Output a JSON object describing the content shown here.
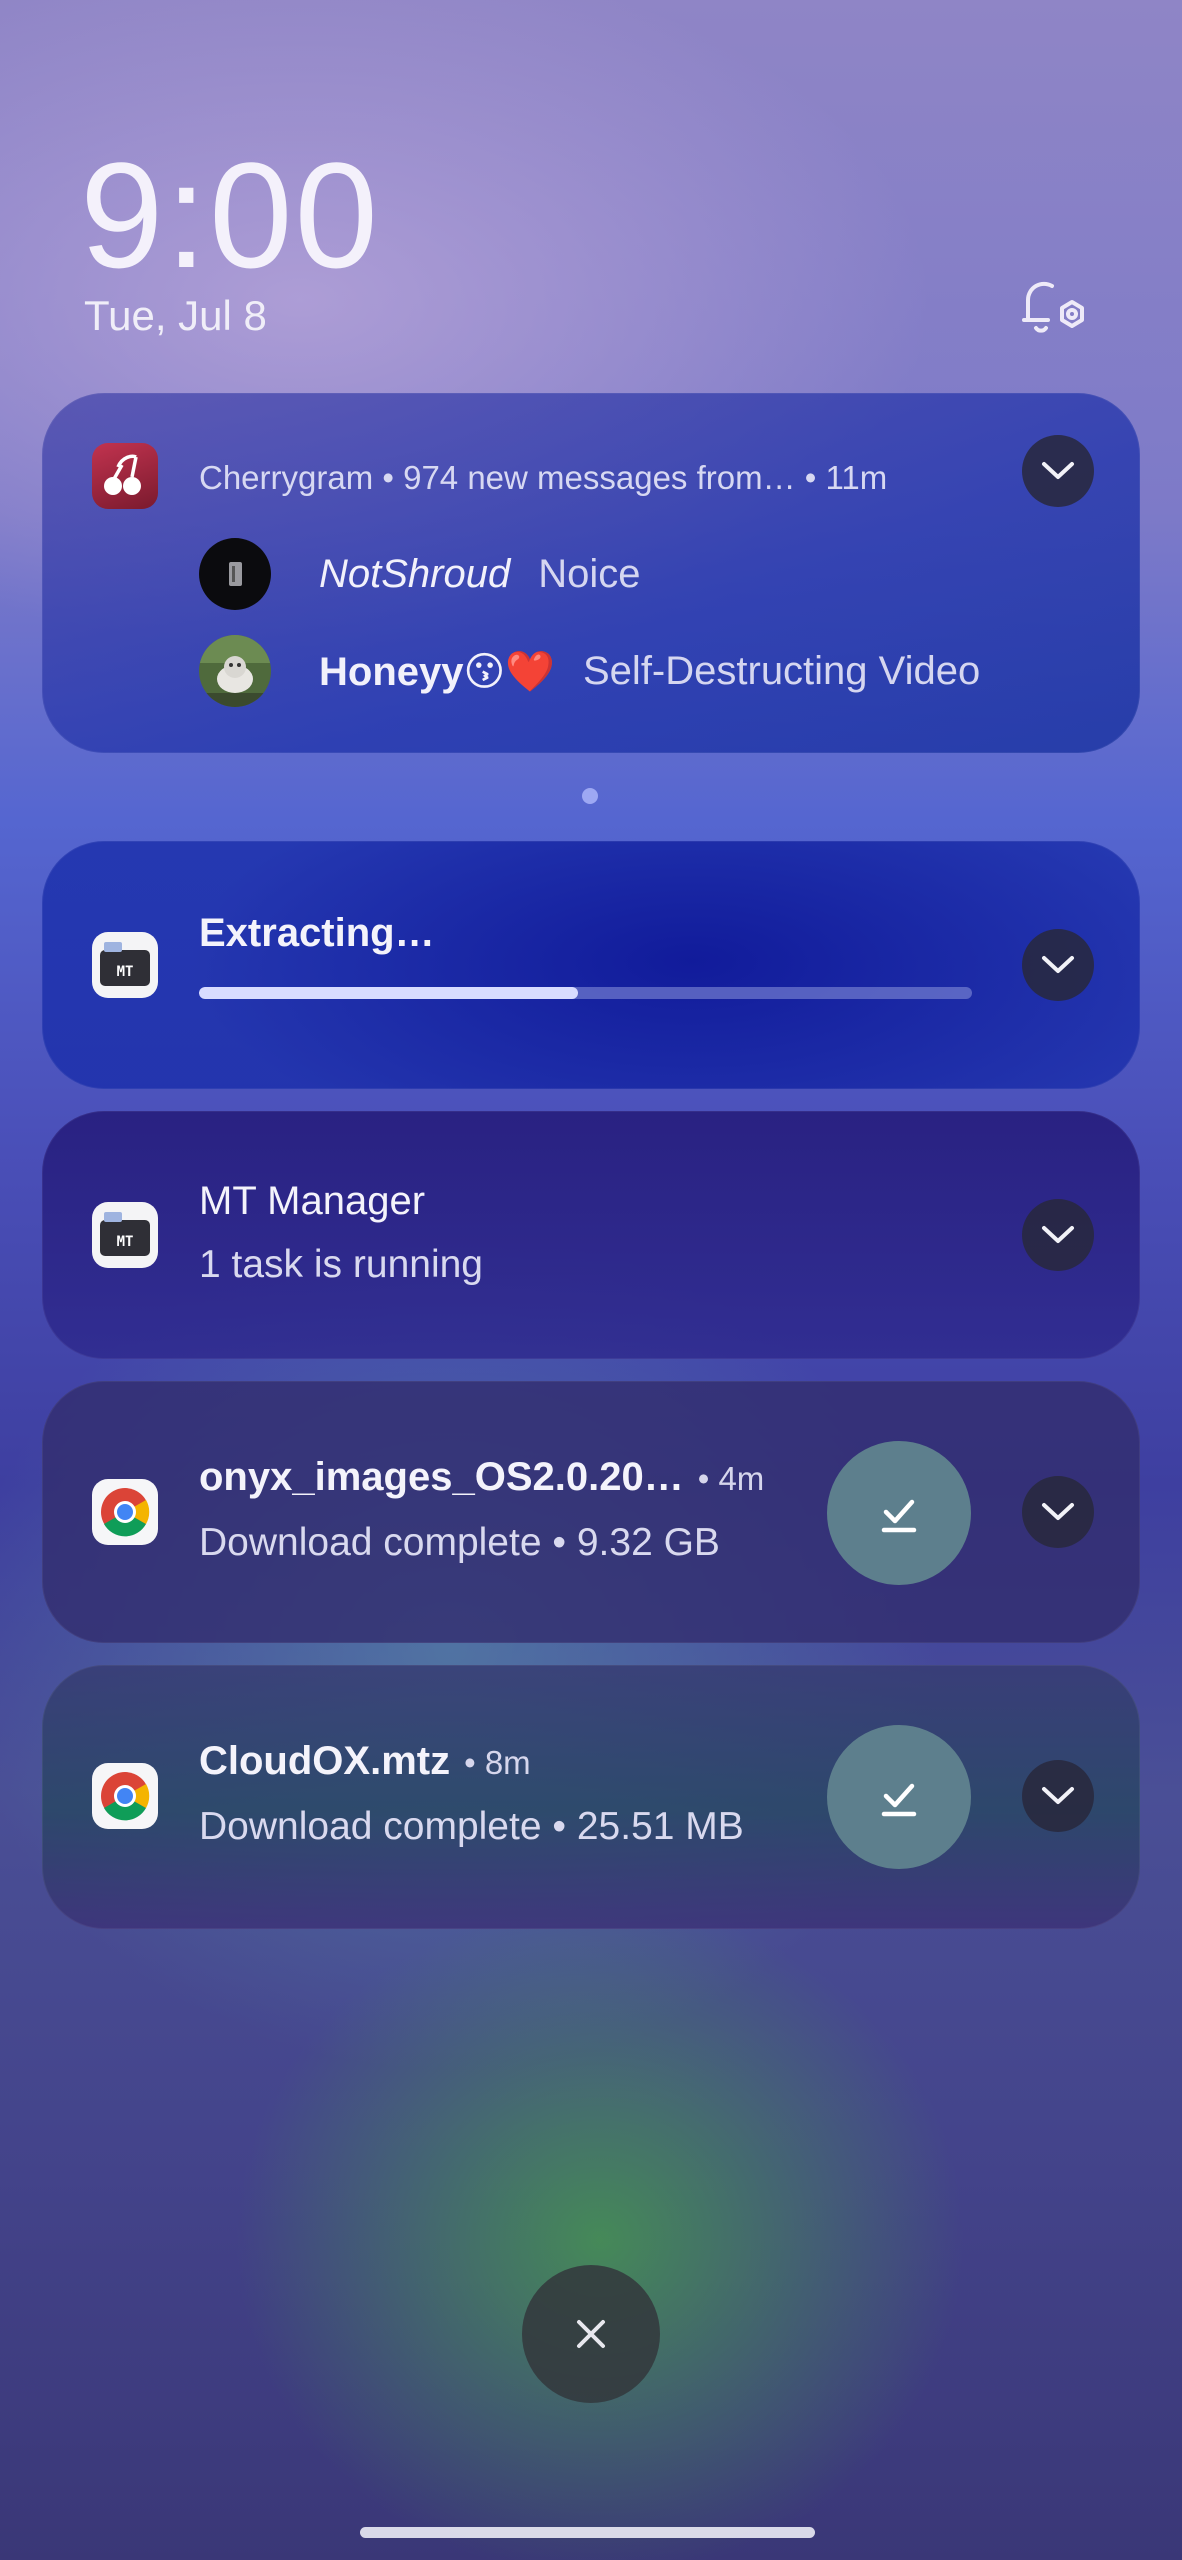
{
  "status": {
    "time": "9:00",
    "date": "Tue, Jul 8",
    "notification_settings_icon": "bell-gear-icon"
  },
  "notifications": {
    "cherrygram": {
      "icon": "cherry-icon",
      "header": "Cherrygram • 974 new messages from… • 11m",
      "messages": [
        {
          "sender": "NotShroud",
          "text": "Noice"
        },
        {
          "sender": "Honeyy😗❤️",
          "text": "Self-Destructing Video"
        }
      ]
    },
    "page_indicator": "dot",
    "extracting": {
      "icon": "mt-manager-icon",
      "title": "Extracting…",
      "progress": 0.49
    },
    "mt_manager": {
      "icon": "mt-manager-icon",
      "title": "MT Manager",
      "subtitle": "1 task is running"
    },
    "download1": {
      "icon": "chrome-icon",
      "title": "onyx_images_OS2.0.20…",
      "meta": "• 4m",
      "subtitle": "Download complete • 9.32 GB",
      "action_icon": "download-done-icon"
    },
    "download2": {
      "icon": "chrome-icon",
      "title": "CloudOX.mtz",
      "meta": "• 8m",
      "subtitle": "Download complete • 25.51 MB",
      "action_icon": "download-done-icon"
    }
  },
  "clear_all_icon": "close-icon",
  "accent": "#5d7f8d"
}
